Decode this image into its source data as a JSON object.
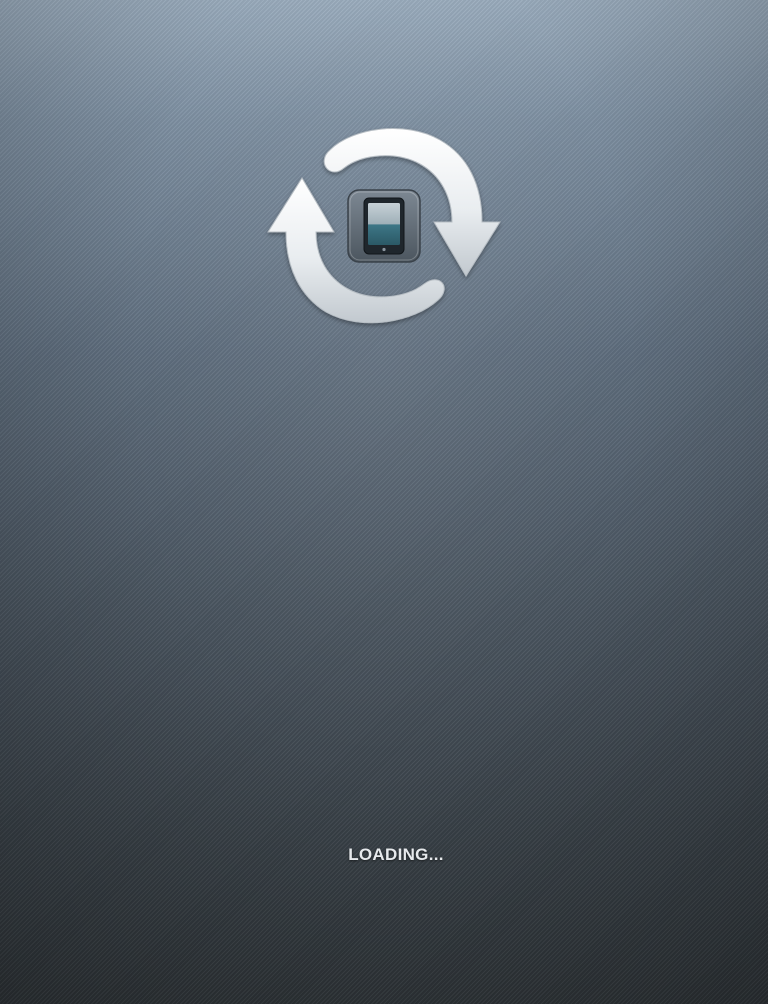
{
  "loading": {
    "label": "LOADING..."
  },
  "logo": {
    "icon": "sync-tablet-icon"
  },
  "colors": {
    "background_top": "#9aacbd",
    "background_bottom": "#2f3539",
    "arrow_fill": "#eef1f3",
    "tablet_screen": "#3a6f7e",
    "label_text": "#e6e9ec"
  }
}
